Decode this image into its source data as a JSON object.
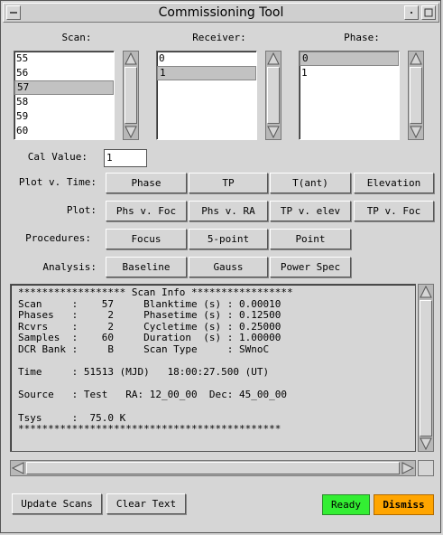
{
  "window": {
    "title": "Commissioning Tool"
  },
  "lists": {
    "scan": {
      "header": "Scan:",
      "items": [
        "55",
        "56",
        "57",
        "58",
        "59",
        "60"
      ],
      "selected_index": 2
    },
    "receiver": {
      "header": "Receiver:",
      "items": [
        "0",
        "1"
      ],
      "selected_index": 1
    },
    "phase": {
      "header": "Phase:",
      "items": [
        "0",
        "1"
      ],
      "selected_index": 0
    }
  },
  "cal": {
    "label": "Cal Value:",
    "value": "1"
  },
  "rows": {
    "plot_time": {
      "label": "Plot v. Time:",
      "buttons": [
        "Phase",
        "TP",
        "T(ant)",
        "Elevation"
      ]
    },
    "plot": {
      "label": "Plot:",
      "buttons": [
        "Phs v. Foc",
        "Phs v. RA",
        "TP v. elev",
        "TP v. Foc"
      ]
    },
    "procedures": {
      "label": "Procedures:",
      "buttons": [
        "Focus",
        "5-point",
        "Point"
      ]
    },
    "analysis": {
      "label": "Analysis:",
      "buttons": [
        "Baseline",
        "Gauss",
        "Power Spec"
      ]
    }
  },
  "scan_info": {
    "lines": [
      "****************** Scan Info *****************",
      "Scan     :    57     Blanktime (s) : 0.00010",
      "Phases   :     2     Phasetime (s) : 0.12500",
      "Rcvrs    :     2     Cycletime (s) : 0.25000",
      "Samples  :    60     Duration  (s) : 1.00000",
      "DCR Bank :     B     Scan Type     : SWnoC",
      "",
      "Time     : 51513 (MJD)   18:00:27.500 (UT)",
      "",
      "Source   : Test   RA: 12_00_00  Dec: 45_00_00",
      "",
      "Tsys     :  75.0 K",
      "********************************************"
    ]
  },
  "footer": {
    "update_scans": "Update Scans",
    "clear_text": "Clear Text",
    "status": "Ready",
    "dismiss": "Dismiss"
  },
  "colors": {
    "ready_bg": "#33ee33",
    "dismiss_bg": "#ffa500"
  }
}
